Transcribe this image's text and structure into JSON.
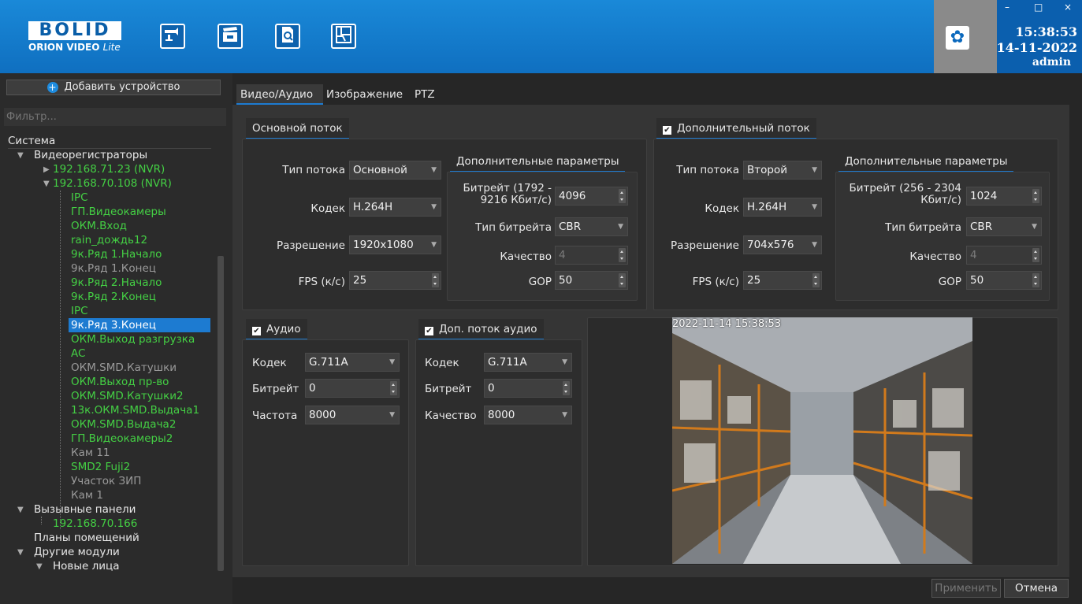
{
  "app": {
    "logo_main": "BOLID",
    "logo_sub": "ORION VIDEO",
    "logo_sub_italic": "Lite",
    "toolbar_icons": [
      "camera-icon",
      "clapperboard-icon",
      "document-search-icon",
      "layout-icon"
    ],
    "time": "15:38:53",
    "date": "14-11-2022",
    "user": "admin",
    "window_controls": [
      "–",
      "□",
      "×"
    ]
  },
  "sidebar": {
    "add_device": "Добавить устройство",
    "filter_placeholder": "Фильтр...",
    "section": "Система",
    "tree": [
      {
        "label": "Видеорегистраторы",
        "color": "wh"
      },
      {
        "label": "192.168.71.23 (NVR)",
        "color": "gr"
      },
      {
        "label": "192.168.70.108 (NVR)",
        "color": "gr"
      },
      {
        "label": "IPC",
        "color": "gr"
      },
      {
        "label": "ГП.Видеокамеры",
        "color": "gr"
      },
      {
        "label": "ОКМ.Вход",
        "color": "gr"
      },
      {
        "label": "rain_дождь12",
        "color": "gr"
      },
      {
        "label": "9к.Ряд 1.Начало",
        "color": "gr"
      },
      {
        "label": "9к.Ряд 1.Конец",
        "color": "gy"
      },
      {
        "label": "9к.Ряд 2.Начало",
        "color": "gr"
      },
      {
        "label": "9к.Ряд 2.Конец",
        "color": "gr"
      },
      {
        "label": "IPC",
        "color": "gr"
      },
      {
        "label": "9к.Ряд 3.Конец",
        "color": "sel"
      },
      {
        "label": "ОКМ.Выход разгрузка",
        "color": "gr"
      },
      {
        "label": "AC",
        "color": "gr"
      },
      {
        "label": "ОКМ.SMD.Катушки",
        "color": "gy"
      },
      {
        "label": "ОКМ.Выход пр-во",
        "color": "gr"
      },
      {
        "label": "ОКМ.SMD.Катушки2",
        "color": "gr"
      },
      {
        "label": "13к.ОКМ.SMD.Выдача1",
        "color": "gr"
      },
      {
        "label": "ОКМ.SMD.Выдача2",
        "color": "gr"
      },
      {
        "label": "ГП.Видеокамеры2",
        "color": "gr"
      },
      {
        "label": "Кам 11",
        "color": "gy"
      },
      {
        "label": "SMD2 Fuji2",
        "color": "gr"
      },
      {
        "label": "Участок ЗИП",
        "color": "gy"
      },
      {
        "label": "Кам 1",
        "color": "gy"
      },
      {
        "label": "Вызывные панели",
        "color": "wh"
      },
      {
        "label": "192.168.70.166",
        "color": "gr"
      },
      {
        "label": "Планы помещений",
        "color": "wh"
      },
      {
        "label": "Другие модули",
        "color": "wh"
      },
      {
        "label": "Новые лица",
        "color": "wh"
      }
    ]
  },
  "tabs": [
    "Видео/Аудио",
    "Изображение",
    "PTZ"
  ],
  "main_stream": {
    "title": "Основной поток",
    "stream_type_label": "Тип потока",
    "stream_type": "Основной",
    "codec_label": "Кодек",
    "codec": "H.264H",
    "resolution_label": "Разрешение",
    "resolution": "1920x1080",
    "fps_label": "FPS (к/с)",
    "fps": "25",
    "extra_title": "Дополнительные параметры",
    "bitrate_label_1": "Битрейт (1792 -",
    "bitrate_label_2": "9216 Кбит/с)",
    "bitrate": "4096",
    "bitrate_type_label": "Тип битрейта",
    "bitrate_type": "CBR",
    "quality_label": "Качество",
    "quality": "4",
    "gop_label": "GOP",
    "gop": "50"
  },
  "sub_stream": {
    "title": "Дополнительный поток",
    "checked": true,
    "stream_type_label": "Тип потока",
    "stream_type": "Второй",
    "codec_label": "Кодек",
    "codec": "H.264H",
    "resolution_label": "Разрешение",
    "resolution": "704x576",
    "fps_label": "FPS (к/с)",
    "fps": "25",
    "extra_title": "Дополнительные параметры",
    "bitrate_label_1": "Битрейт (256 - 2304",
    "bitrate_label_2": "Кбит/с)",
    "bitrate": "1024",
    "bitrate_type_label": "Тип битрейта",
    "bitrate_type": "CBR",
    "quality_label": "Качество",
    "quality": "4",
    "gop_label": "GOP",
    "gop": "50"
  },
  "audio": {
    "title": "Аудио",
    "codec_label": "Кодек",
    "codec": "G.711A",
    "bitrate_label": "Битрейт",
    "bitrate": "0",
    "freq_label": "Частота",
    "freq": "8000"
  },
  "sub_audio": {
    "title": "Доп. поток аудио",
    "codec_label": "Кодек",
    "codec": "G.711A",
    "bitrate_label": "Битрейт",
    "bitrate": "0",
    "quality_label": "Качество",
    "quality": "8000"
  },
  "preview": {
    "timestamp": "2022-11-14 15:38:53"
  },
  "footer": {
    "apply": "Применить",
    "cancel": "Отмена"
  }
}
